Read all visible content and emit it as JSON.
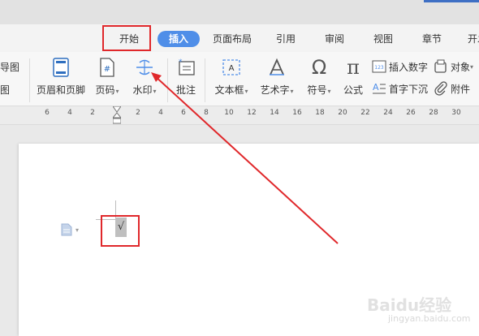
{
  "menu": {
    "items": [
      {
        "label": "开始"
      },
      {
        "label": "插入"
      },
      {
        "label": "页面布局"
      },
      {
        "label": "引用"
      },
      {
        "label": "审阅"
      },
      {
        "label": "视图"
      },
      {
        "label": "章节"
      },
      {
        "label": "开发"
      }
    ]
  },
  "ribbon": {
    "left_cut_top": "导图",
    "left_cut_bottom": "图",
    "tools": [
      {
        "label": "页眉和页脚",
        "icon": "header-footer-icon"
      },
      {
        "label": "页码",
        "icon": "page-number-icon"
      },
      {
        "label": "水印",
        "icon": "watermark-icon"
      },
      {
        "label": "批注",
        "icon": "comment-icon"
      },
      {
        "label": "文本框",
        "icon": "textbox-icon"
      },
      {
        "label": "艺术字",
        "icon": "wordart-icon"
      },
      {
        "label": "符号",
        "icon": "omega-symbol-icon"
      },
      {
        "label": "公式",
        "icon": "pi-formula-icon"
      }
    ],
    "page_number_glyph": "#",
    "symbol_glyph": "Ω",
    "formula_glyph": "π",
    "right_tools": [
      {
        "label": "插入数字",
        "icon": "insert-number-icon",
        "glyph": "123"
      },
      {
        "label": "对象",
        "icon": "object-icon"
      },
      {
        "label": "首字下沉",
        "icon": "drop-cap-icon"
      },
      {
        "label": "附件",
        "icon": "attachment-icon"
      }
    ]
  },
  "ruler": {
    "ticks": [
      "6",
      "4",
      "2",
      "2",
      "4",
      "6",
      "8",
      "10",
      "12",
      "14",
      "16",
      "18",
      "20",
      "22",
      "24",
      "26",
      "28",
      "30"
    ]
  },
  "document": {
    "selected_text": "√"
  },
  "watermark": {
    "brand": "Baidu经验",
    "sub": "jingyan.baidu.com"
  },
  "colors": {
    "accent": "#4f8ee8",
    "annotation_red": "#e0282b"
  }
}
